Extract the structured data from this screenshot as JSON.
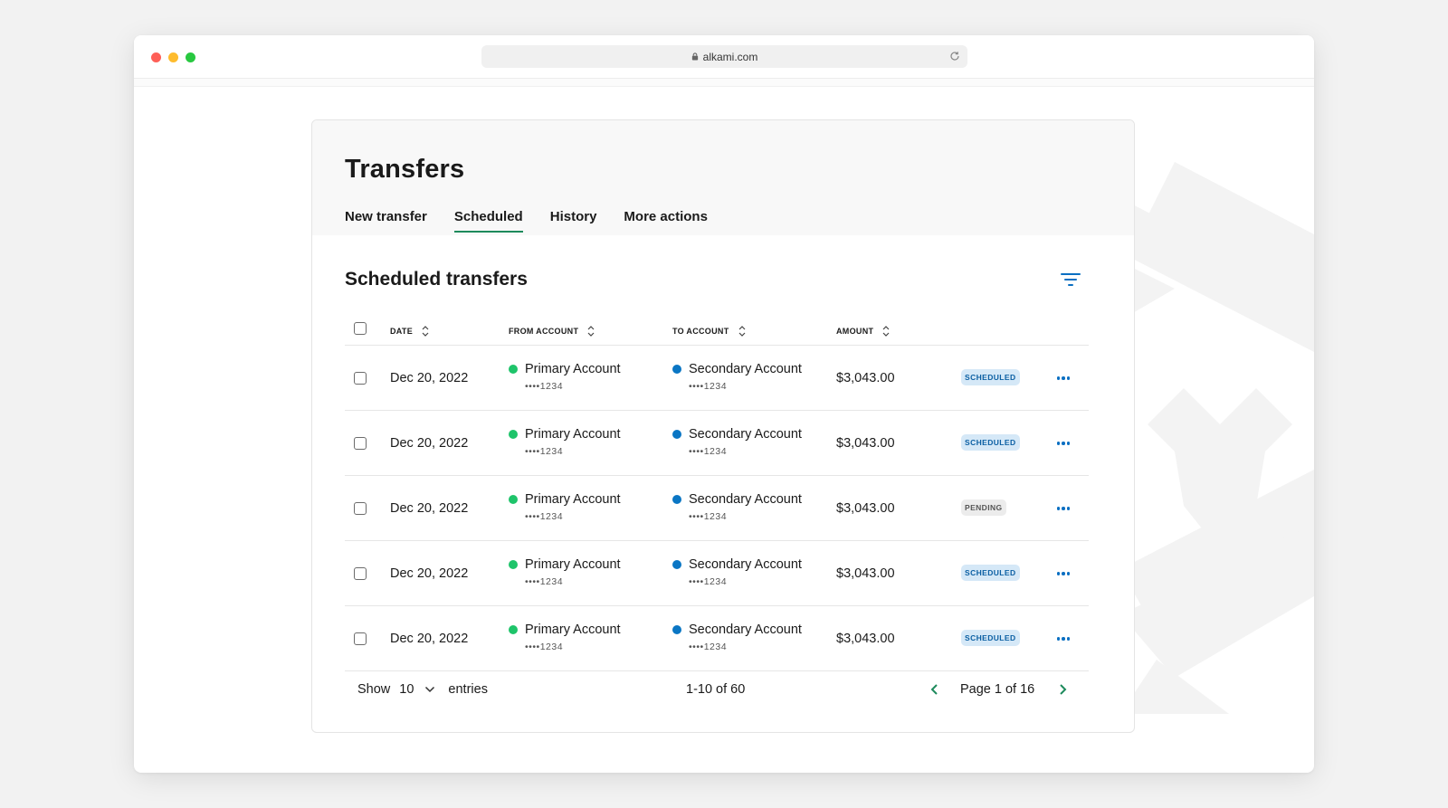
{
  "browser": {
    "url": "alkami.com"
  },
  "page": {
    "title": "Transfers",
    "tabs": [
      {
        "label": "New transfer",
        "active": false
      },
      {
        "label": "Scheduled",
        "active": true
      },
      {
        "label": "History",
        "active": false
      },
      {
        "label": "More actions",
        "active": false
      }
    ]
  },
  "section": {
    "title": "Scheduled transfers",
    "filter_icon": "filter-icon"
  },
  "table": {
    "headers": {
      "date": "DATE",
      "from": "FROM ACCOUNT",
      "to": "TO ACCOUNT",
      "amount": "AMOUNT"
    },
    "rows": [
      {
        "date": "Dec 20, 2022",
        "from": "Primary Account",
        "from_num": "••••1234",
        "to": "Secondary Account",
        "to_num": "••••1234",
        "amount": "$3,043.00",
        "status": "SCHEDULED"
      },
      {
        "date": "Dec 20, 2022",
        "from": "Primary Account",
        "from_num": "••••1234",
        "to": "Secondary Account",
        "to_num": "••••1234",
        "amount": "$3,043.00",
        "status": "SCHEDULED"
      },
      {
        "date": "Dec 20, 2022",
        "from": "Primary Account",
        "from_num": "••••1234",
        "to": "Secondary Account",
        "to_num": "••••1234",
        "amount": "$3,043.00",
        "status": "PENDING"
      },
      {
        "date": "Dec 20, 2022",
        "from": "Primary Account",
        "from_num": "••••1234",
        "to": "Secondary Account",
        "to_num": "••••1234",
        "amount": "$3,043.00",
        "status": "SCHEDULED"
      },
      {
        "date": "Dec 20, 2022",
        "from": "Primary Account",
        "from_num": "••••1234",
        "to": "Secondary Account",
        "to_num": "••••1234",
        "amount": "$3,043.00",
        "status": "SCHEDULED"
      }
    ]
  },
  "pagination": {
    "show_label": "Show",
    "show_value": "10",
    "entries_label": "entries",
    "range": "1-10 of 60",
    "page_info": "Page  1 of 16"
  },
  "colors": {
    "accent_green": "#1d8a5c",
    "from_dot": "#1ec46a",
    "to_dot": "#0a76c4",
    "link_blue": "#0a6fc2"
  }
}
